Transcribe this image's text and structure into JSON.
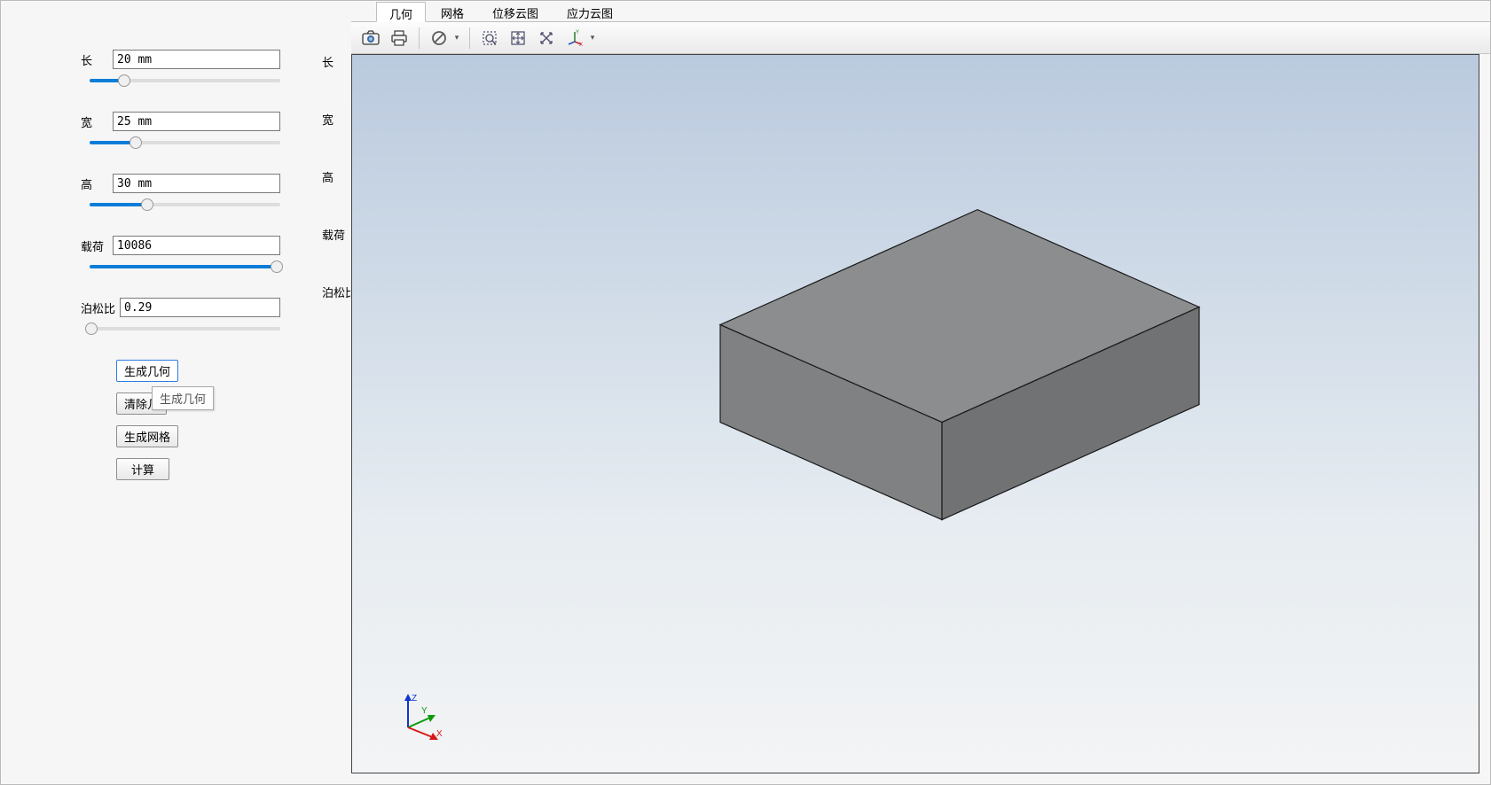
{
  "params": {
    "length": {
      "label": "长",
      "value": "20 mm",
      "slider": 18
    },
    "width": {
      "label": "宽",
      "value": "25 mm",
      "slider": 24
    },
    "height": {
      "label": "高",
      "value": "30 mm",
      "slider": 30
    },
    "load": {
      "label": "载荷",
      "value": "10086",
      "slider": 98
    },
    "poisson": {
      "label": "泊松比",
      "value": "0.29",
      "slider": 1
    }
  },
  "rightLabels": {
    "length": "长",
    "width": "宽",
    "height": "高",
    "load": "载荷",
    "poisson": "泊松比"
  },
  "buttons": {
    "genGeom": "生成几何",
    "clearGeom": "清除几",
    "genMesh": "生成网格",
    "compute": "计算"
  },
  "tooltip": "生成几何",
  "tabs": {
    "geom": "几何",
    "mesh": "网格",
    "disp": "位移云图",
    "stress": "应力云图",
    "active": "geom"
  },
  "toolbar": {
    "camera": "camera",
    "print": "print",
    "forbid": "forbid",
    "zoomBox": "zoom-box",
    "fit": "fit-view",
    "zoomExtents": "cross-zoom",
    "axes": "axes-orient"
  },
  "axis": {
    "x": "X",
    "y": "Y",
    "z": "Z"
  },
  "geometry": {
    "shape": "rectangular-block",
    "color_top": "#8b8d8e",
    "color_front": "#7f8182",
    "color_side": "#707273"
  }
}
